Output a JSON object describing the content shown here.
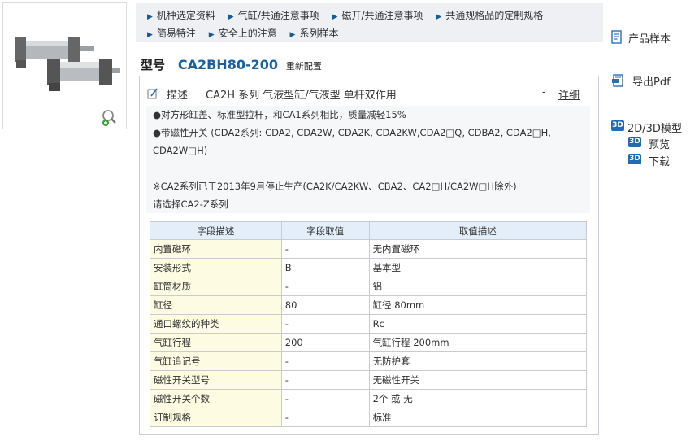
{
  "nav": {
    "row1": [
      "机种选定资料",
      "气缸/共通注意事项",
      "磁开/共通注意事项",
      "共通规格品的定制规格"
    ],
    "row2": [
      "简易特注",
      "安全上的注意",
      "系列样本"
    ]
  },
  "model": {
    "label": "型号",
    "code": "CA2BH80-200",
    "sub": "重新配置"
  },
  "description": {
    "label": "描述",
    "summary": "CA2H 系列 气液型缸/气液型 单杆双作用",
    "dash": "-",
    "detail_link": "详细",
    "lines": [
      "●对方形缸盖、标准型拉杆，和CA1系列相比，质量减轻15%",
      "●带磁性开关 (CDA2系列: CDA2, CDA2W, CDA2K, CDA2KW,CDA2□Q, CDBA2, CDA2□H,",
      "CDA2W□H)",
      "",
      "※CA2系列已于2013年9月停止生产(CA2K/CA2KW、CBA2、CA2□H/CA2W□H除外)",
      "请选择CA2-Z系列"
    ]
  },
  "table": {
    "headers": [
      "字段描述",
      "字段取值",
      "取值描述"
    ],
    "rows": [
      [
        "内置磁环",
        "-",
        "无内置磁环"
      ],
      [
        "安装形式",
        "B",
        "基本型"
      ],
      [
        "缸筒材质",
        "-",
        "铝"
      ],
      [
        "缸径",
        "80",
        "缸径 80mm"
      ],
      [
        "通口螺纹的种类",
        "-",
        "Rc"
      ],
      [
        "气缸行程",
        "200",
        "气缸行程 200mm"
      ],
      [
        "气缸追记号",
        "-",
        "无防护套"
      ],
      [
        "磁性开关型号",
        "-",
        "无磁性开关"
      ],
      [
        "磁性开关个数",
        "-",
        "2个 或 无"
      ],
      [
        "订制规格",
        "-",
        "标准"
      ]
    ]
  },
  "sidebar": {
    "catalog": "产品样本",
    "export_pdf": "导出Pdf",
    "model_3d": "2D/3D模型",
    "preview": "预览",
    "download": "下载",
    "badge": "3D"
  },
  "colors": {
    "accent": "#1b5f9e",
    "nav_bg": "#eef0f4",
    "table_header": "#e3eef8",
    "field_cell": "#fdfbe2"
  },
  "icons": [
    "magnify-plus-icon",
    "pencil-icon",
    "catalog-icon",
    "pdf-export-icon",
    "3d-badge-icon"
  ]
}
